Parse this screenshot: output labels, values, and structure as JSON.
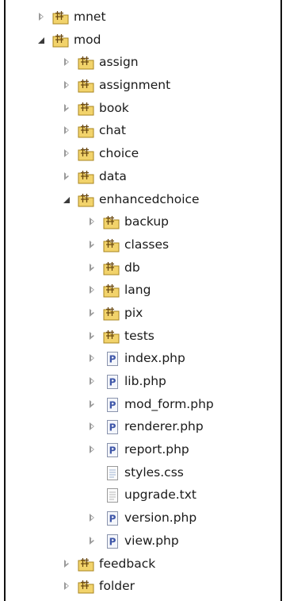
{
  "tree": {
    "mnet": "mnet",
    "mod": "mod",
    "assign": "assign",
    "assignment": "assignment",
    "book": "book",
    "chat": "chat",
    "choice": "choice",
    "data": "data",
    "enhancedchoice": "enhancedchoice",
    "backup": "backup",
    "classes": "classes",
    "db": "db",
    "lang": "lang",
    "pix": "pix",
    "tests": "tests",
    "index_php": "index.php",
    "lib_php": "lib.php",
    "mod_form_php": "mod_form.php",
    "renderer_php": "renderer.php",
    "report_php": "report.php",
    "styles_css": "styles.css",
    "upgrade_txt": "upgrade.txt",
    "version_php": "version.php",
    "view_php": "view.php",
    "feedback": "feedback",
    "folder": "folder"
  },
  "icons": {
    "folder": "package-folder-icon",
    "php": "php-file-icon",
    "text": "text-file-icon",
    "expand": "expand-arrow-icon",
    "collapse": "collapse-arrow-icon"
  },
  "colors": {
    "folder_yellow": "#f2d36b",
    "folder_outline": "#a8841f",
    "php_blue": "#3d55a8",
    "tree_text": "#1a1a1a"
  }
}
